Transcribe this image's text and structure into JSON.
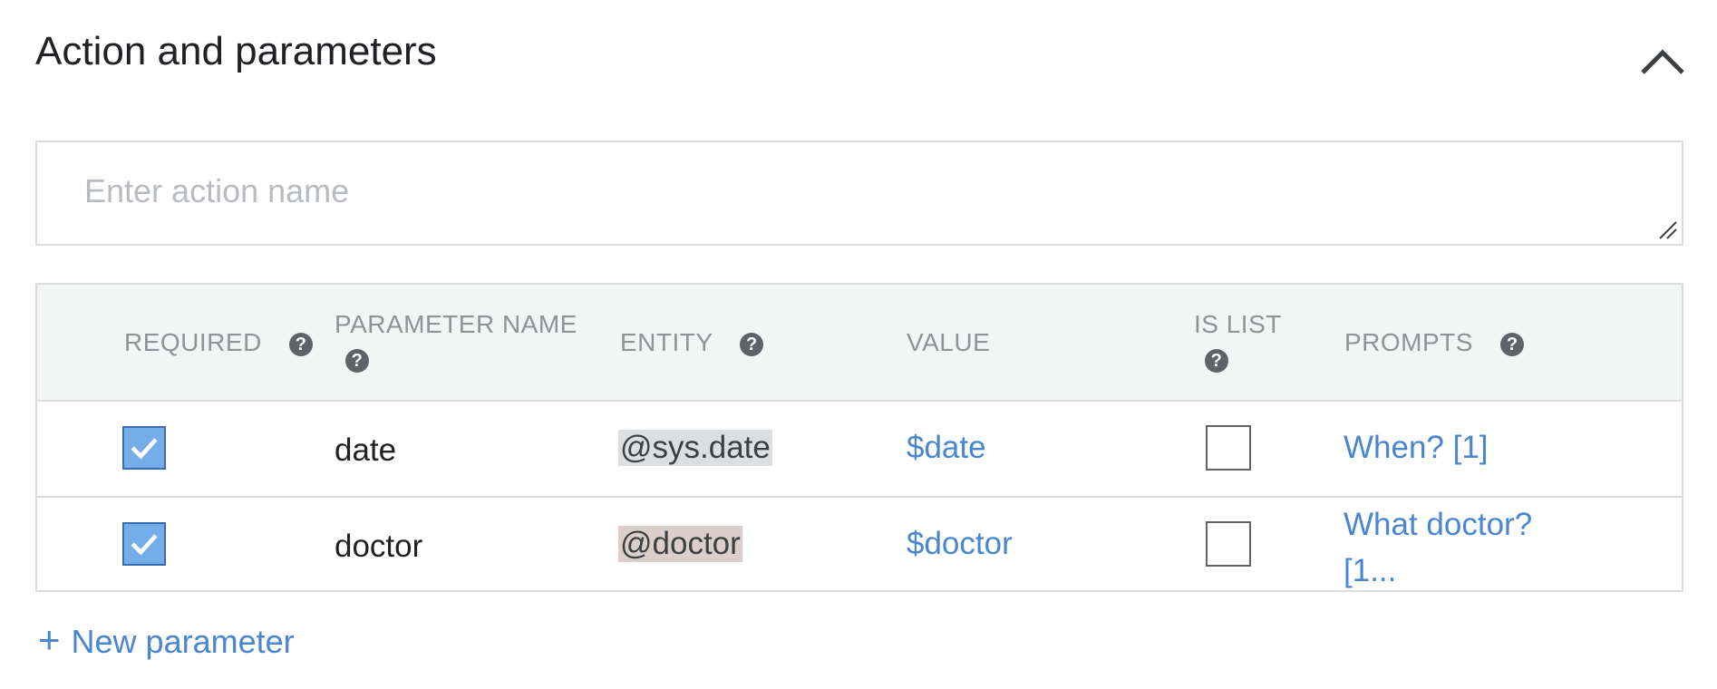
{
  "section": {
    "title": "Action and parameters",
    "collapse_icon": "chevron-up-icon"
  },
  "action": {
    "placeholder": "Enter action name",
    "value": ""
  },
  "table": {
    "headers": {
      "required": "REQUIRED",
      "parameter_name_1": "PARAMETER NAME",
      "entity": "ENTITY",
      "value": "VALUE",
      "is_list_1": "IS LIST",
      "prompts": "PROMPTS"
    },
    "help_glyph": "?",
    "rows": [
      {
        "required": true,
        "name": "date",
        "entity": "@sys.date",
        "entity_bg": "#dcdfe2",
        "value": "$date",
        "is_list": false,
        "prompts_1": "When? [1]",
        "prompts_2": ""
      },
      {
        "required": true,
        "name": "doctor",
        "entity": "@doctor",
        "entity_bg": "#dccfcb",
        "value": "$doctor",
        "is_list": false,
        "prompts_1": "What doctor?",
        "prompts_2": "[1..."
      }
    ]
  },
  "new_parameter": {
    "plus": "+",
    "label": "New parameter"
  },
  "colors": {
    "accent": "#4a86cf",
    "checkbox": "#74ade9",
    "header_bg": "#f3f4f4",
    "border": "#dadce0"
  }
}
